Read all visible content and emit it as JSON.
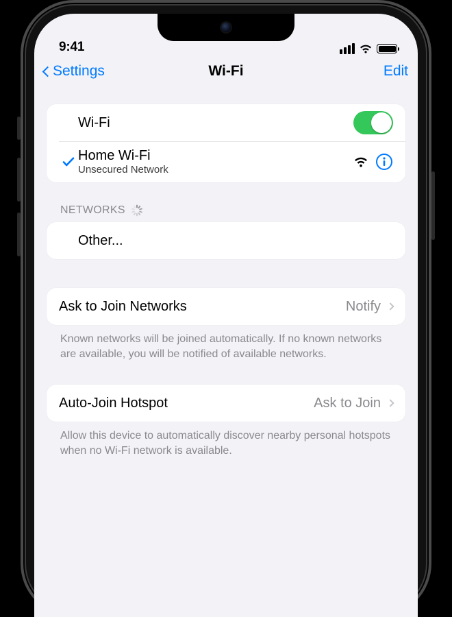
{
  "status": {
    "time": "9:41"
  },
  "nav": {
    "back_label": "Settings",
    "title": "Wi-Fi",
    "edit_label": "Edit"
  },
  "wifi": {
    "toggle_label": "Wi-Fi",
    "toggle_on": true,
    "connected": {
      "name": "Home Wi-Fi",
      "subtitle": "Unsecured Network"
    }
  },
  "networks": {
    "header": "NETWORKS",
    "other_label": "Other..."
  },
  "ask_join": {
    "label": "Ask to Join Networks",
    "value": "Notify",
    "footer": "Known networks will be joined automatically. If no known networks are available, you will be notified of available networks."
  },
  "auto_hotspot": {
    "label": "Auto-Join Hotspot",
    "value": "Ask to Join",
    "footer": "Allow this device to automatically discover nearby personal hotspots when no Wi-Fi network is available."
  },
  "colors": {
    "tint": "#007aff",
    "switch_on": "#34c759"
  }
}
